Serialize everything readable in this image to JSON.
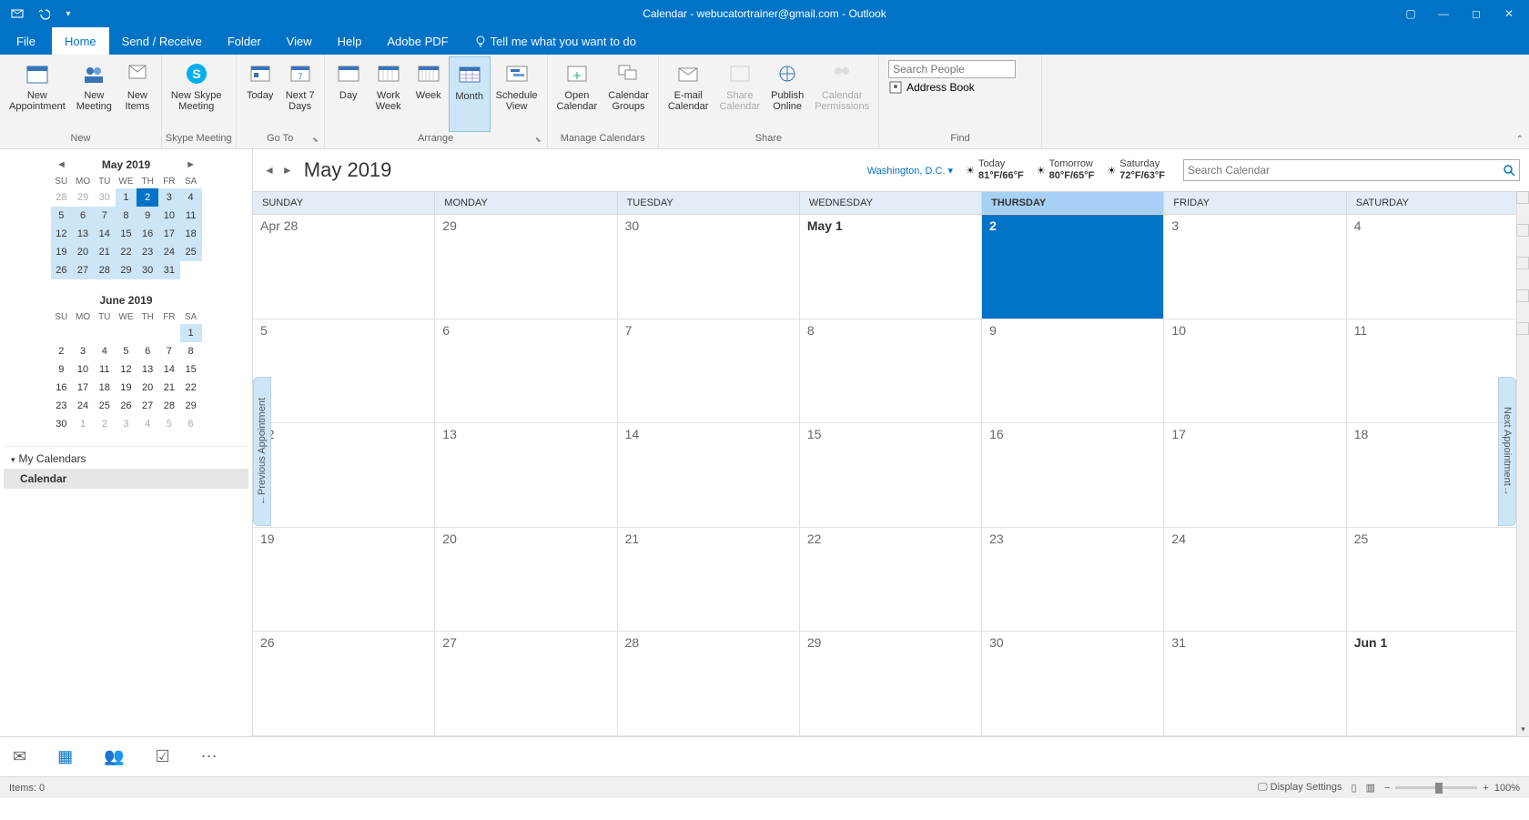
{
  "title": "Calendar - webucatortrainer@gmail.com  -  Outlook",
  "tabs": [
    "File",
    "Home",
    "Send / Receive",
    "Folder",
    "View",
    "Help",
    "Adobe PDF"
  ],
  "tell_me": "Tell me what you want to do",
  "ribbon": {
    "new": {
      "label": "New",
      "appointment": "New\nAppointment",
      "meeting": "New\nMeeting",
      "items": "New\nItems"
    },
    "skype": {
      "label": "Skype Meeting",
      "btn": "New Skype\nMeeting"
    },
    "goto": {
      "label": "Go To",
      "today": "Today",
      "next7": "Next 7\nDays"
    },
    "arrange": {
      "label": "Arrange",
      "day": "Day",
      "workweek": "Work\nWeek",
      "week": "Week",
      "month": "Month",
      "schedule": "Schedule\nView"
    },
    "manage": {
      "label": "Manage Calendars",
      "open": "Open\nCalendar",
      "groups": "Calendar\nGroups"
    },
    "share": {
      "label": "Share",
      "email": "E-mail\nCalendar",
      "sharecal": "Share\nCalendar",
      "publish": "Publish\nOnline",
      "perm": "Calendar\nPermissions"
    },
    "find": {
      "label": "Find",
      "search_placeholder": "Search People",
      "addressbook": "Address Book"
    }
  },
  "minicals": [
    {
      "title": "May 2019",
      "showNav": true,
      "dow": [
        "SU",
        "MO",
        "TU",
        "WE",
        "TH",
        "FR",
        "SA"
      ],
      "rows": [
        [
          {
            "d": "28",
            "pm": 1
          },
          {
            "d": "29",
            "pm": 1
          },
          {
            "d": "30",
            "pm": 1
          },
          {
            "d": "1",
            "hl": 1
          },
          {
            "d": "2",
            "today": 1
          },
          {
            "d": "3",
            "hl": 1
          },
          {
            "d": "4",
            "hl": 1
          }
        ],
        [
          {
            "d": "5",
            "hl": 1
          },
          {
            "d": "6",
            "hl": 1
          },
          {
            "d": "7",
            "hl": 1
          },
          {
            "d": "8",
            "hl": 1
          },
          {
            "d": "9",
            "hl": 1
          },
          {
            "d": "10",
            "hl": 1
          },
          {
            "d": "11",
            "hl": 1
          }
        ],
        [
          {
            "d": "12",
            "hl": 1
          },
          {
            "d": "13",
            "hl": 1
          },
          {
            "d": "14",
            "hl": 1
          },
          {
            "d": "15",
            "hl": 1
          },
          {
            "d": "16",
            "hl": 1
          },
          {
            "d": "17",
            "hl": 1
          },
          {
            "d": "18",
            "hl": 1
          }
        ],
        [
          {
            "d": "19",
            "hl": 1
          },
          {
            "d": "20",
            "hl": 1
          },
          {
            "d": "21",
            "hl": 1
          },
          {
            "d": "22",
            "hl": 1
          },
          {
            "d": "23",
            "hl": 1
          },
          {
            "d": "24",
            "hl": 1
          },
          {
            "d": "25",
            "hl": 1
          }
        ],
        [
          {
            "d": "26",
            "hl": 1
          },
          {
            "d": "27",
            "hl": 1
          },
          {
            "d": "28",
            "hl": 1
          },
          {
            "d": "29",
            "hl": 1
          },
          {
            "d": "30",
            "hl": 1
          },
          {
            "d": "31",
            "hl": 1
          },
          {
            "d": ""
          }
        ]
      ]
    },
    {
      "title": "June 2019",
      "showNav": false,
      "dow": [
        "SU",
        "MO",
        "TU",
        "WE",
        "TH",
        "FR",
        "SA"
      ],
      "rows": [
        [
          {
            "d": ""
          },
          {
            "d": ""
          },
          {
            "d": ""
          },
          {
            "d": ""
          },
          {
            "d": ""
          },
          {
            "d": ""
          },
          {
            "d": "1",
            "hl": 1
          }
        ],
        [
          {
            "d": "2"
          },
          {
            "d": "3"
          },
          {
            "d": "4"
          },
          {
            "d": "5"
          },
          {
            "d": "6"
          },
          {
            "d": "7"
          },
          {
            "d": "8"
          }
        ],
        [
          {
            "d": "9"
          },
          {
            "d": "10"
          },
          {
            "d": "11"
          },
          {
            "d": "12"
          },
          {
            "d": "13"
          },
          {
            "d": "14"
          },
          {
            "d": "15"
          }
        ],
        [
          {
            "d": "16"
          },
          {
            "d": "17"
          },
          {
            "d": "18"
          },
          {
            "d": "19"
          },
          {
            "d": "20"
          },
          {
            "d": "21"
          },
          {
            "d": "22"
          }
        ],
        [
          {
            "d": "23"
          },
          {
            "d": "24"
          },
          {
            "d": "25"
          },
          {
            "d": "26"
          },
          {
            "d": "27"
          },
          {
            "d": "28"
          },
          {
            "d": "29"
          }
        ],
        [
          {
            "d": "30"
          },
          {
            "d": "1",
            "pm": 1
          },
          {
            "d": "2",
            "pm": 1
          },
          {
            "d": "3",
            "pm": 1
          },
          {
            "d": "4",
            "pm": 1
          },
          {
            "d": "5",
            "pm": 1
          },
          {
            "d": "6",
            "pm": 1
          }
        ]
      ]
    }
  ],
  "mycalendars": {
    "header": "My Calendars",
    "item": "Calendar"
  },
  "calheader": {
    "title": "May 2019",
    "location": "Washington,  D.C.",
    "weather": [
      {
        "label": "Today",
        "temp": "81°F/66°F"
      },
      {
        "label": "Tomorrow",
        "temp": "80°F/65°F"
      },
      {
        "label": "Saturday",
        "temp": "72°F/63°F"
      }
    ],
    "search_placeholder": "Search Calendar"
  },
  "dayheaders": [
    "SUNDAY",
    "MONDAY",
    "TUESDAY",
    "WEDNESDAY",
    "THURSDAY",
    "FRIDAY",
    "SATURDAY"
  ],
  "today_col": 4,
  "weeks": [
    [
      {
        "d": "Apr 28"
      },
      {
        "d": "29"
      },
      {
        "d": "30"
      },
      {
        "d": "May 1",
        "bold": 1
      },
      {
        "d": "2",
        "today": 1
      },
      {
        "d": "3"
      },
      {
        "d": "4"
      }
    ],
    [
      {
        "d": "5"
      },
      {
        "d": "6"
      },
      {
        "d": "7"
      },
      {
        "d": "8"
      },
      {
        "d": "9"
      },
      {
        "d": "10"
      },
      {
        "d": "11"
      }
    ],
    [
      {
        "d": "12"
      },
      {
        "d": "13"
      },
      {
        "d": "14"
      },
      {
        "d": "15"
      },
      {
        "d": "16"
      },
      {
        "d": "17"
      },
      {
        "d": "18"
      }
    ],
    [
      {
        "d": "19"
      },
      {
        "d": "20"
      },
      {
        "d": "21"
      },
      {
        "d": "22"
      },
      {
        "d": "23"
      },
      {
        "d": "24"
      },
      {
        "d": "25"
      }
    ],
    [
      {
        "d": "26"
      },
      {
        "d": "27"
      },
      {
        "d": "28"
      },
      {
        "d": "29"
      },
      {
        "d": "30"
      },
      {
        "d": "31"
      },
      {
        "d": "Jun 1",
        "bold": 1
      }
    ]
  ],
  "prev_apt": "Previous Appointment",
  "next_apt": "Next Appointment",
  "status": {
    "items": "Items: 0",
    "display": "Display Settings",
    "zoom": "100%"
  }
}
